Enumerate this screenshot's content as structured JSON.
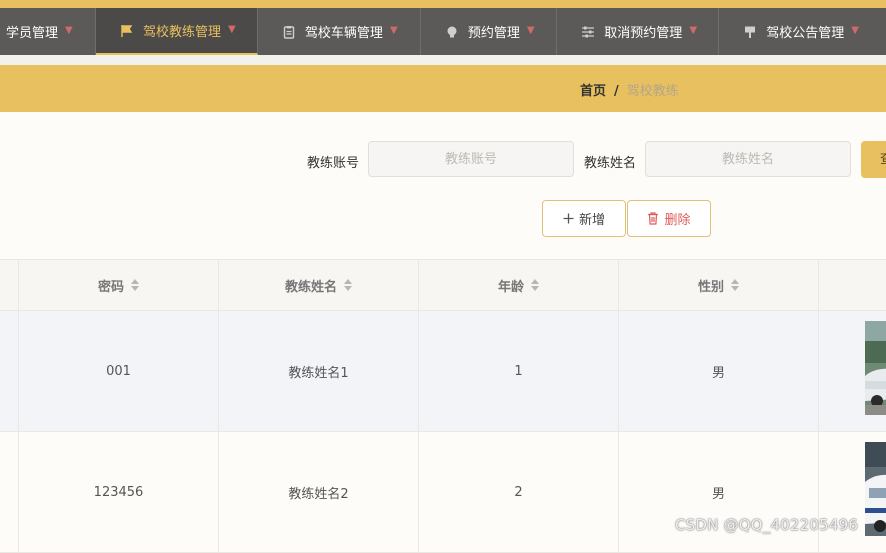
{
  "nav": {
    "items": [
      {
        "label": "学员管理",
        "active": false
      },
      {
        "label": "驾校教练管理",
        "active": true
      },
      {
        "label": "驾校车辆管理",
        "active": false
      },
      {
        "label": "预约管理",
        "active": false
      },
      {
        "label": "取消预约管理",
        "active": false
      },
      {
        "label": "驾校公告管理",
        "active": false
      }
    ]
  },
  "breadcrumb": {
    "home": "首页",
    "separator": "/",
    "current": "驾校教练"
  },
  "search": {
    "account_label": "教练账号",
    "account_placeholder": "教练账号",
    "name_label": "教练姓名",
    "name_placeholder": "教练姓名",
    "query_label": "查询"
  },
  "actions": {
    "add_label": "新增",
    "delete_label": "删除"
  },
  "table": {
    "headers": [
      "密码",
      "教练姓名",
      "年龄",
      "性别"
    ],
    "rows": [
      {
        "password": "001",
        "name": "教练姓名1",
        "age": "1",
        "gender": "男"
      },
      {
        "password": "123456",
        "name": "教练姓名2",
        "age": "2",
        "gender": "男"
      }
    ]
  },
  "watermark": "CSDN @QQ_402205496",
  "colors": {
    "accent": "#e9c05f",
    "nav_bg": "#5b5a58",
    "danger": "#e05a5a"
  }
}
